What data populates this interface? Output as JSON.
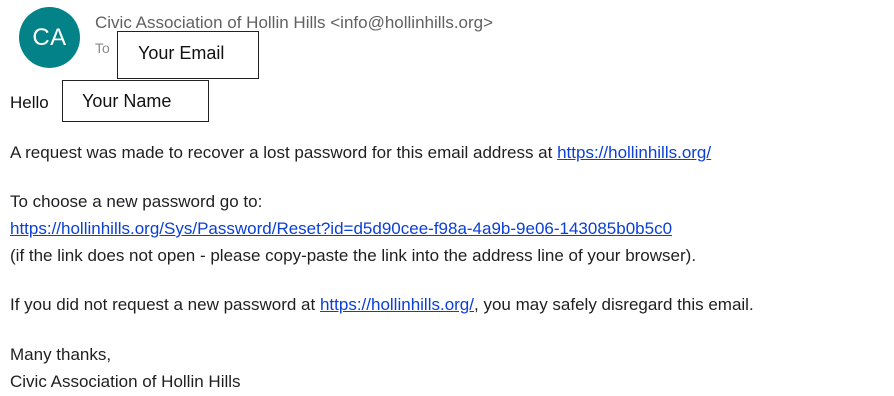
{
  "sender": {
    "initials": "CA",
    "avatar_color": "#038387",
    "display": "Civic Association of Hollin Hills <info@hollinhills.org>"
  },
  "recipient": {
    "to_label": "To",
    "email_placeholder": "Your Email"
  },
  "greeting": {
    "hello": "Hello",
    "name_placeholder": "Your Name"
  },
  "body": {
    "request_text": "A request was made to recover a lost password for this email address at ",
    "site_link": "https://hollinhills.org/",
    "choose_text": "To choose a new password go to:",
    "reset_link": "https://hollinhills.org/Sys/Password/Reset?id=d5d90cee-f98a-4a9b-9e06-143085b0b5c0",
    "fallback_text": "(if the link does not open - please copy-paste the link into the address line of your browser).",
    "disregard_prefix": "If you did not request a new password at ",
    "disregard_link": "https://hollinhills.org/",
    "disregard_suffix": ", you may safely disregard this email.",
    "thanks": "Many thanks,",
    "signature": "Civic Association of Hollin Hills"
  },
  "colors": {
    "link": "#0b3fd6",
    "muted_text": "#616161"
  }
}
